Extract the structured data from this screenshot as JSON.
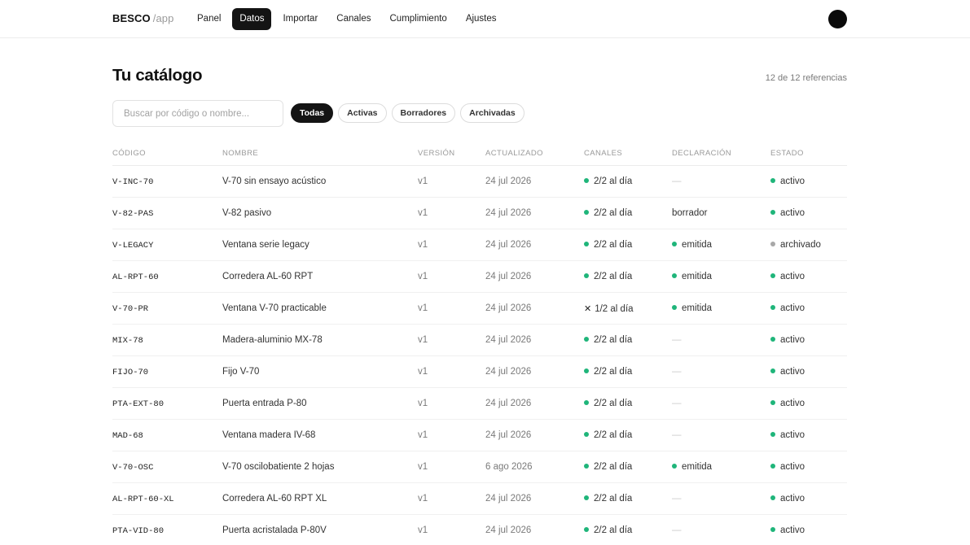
{
  "brand": {
    "name": "BESCO",
    "sub": "/app"
  },
  "nav": [
    {
      "label": "Panel",
      "active": false
    },
    {
      "label": "Datos",
      "active": true
    },
    {
      "label": "Importar",
      "active": false
    },
    {
      "label": "Canales",
      "active": false
    },
    {
      "label": "Cumplimiento",
      "active": false
    },
    {
      "label": "Ajustes",
      "active": false
    }
  ],
  "page": {
    "title": "Tu catálogo",
    "count": "12 de 12 referencias"
  },
  "search": {
    "placeholder": "Buscar por código o nombre...",
    "value": ""
  },
  "filters": [
    {
      "label": "Todas",
      "active": true
    },
    {
      "label": "Activas",
      "active": false
    },
    {
      "label": "Borradores",
      "active": false
    },
    {
      "label": "Archivadas",
      "active": false
    }
  ],
  "table": {
    "headers": [
      "Código",
      "Nombre",
      "Versión",
      "Actualizado",
      "Canales",
      "Declaración",
      "Estado"
    ],
    "rows": [
      {
        "code": "V-INC-70",
        "name": "V-70 sin ensayo acústico",
        "version": "v1",
        "updated": "24 jul 2026",
        "channels": "2/2 al día",
        "channels_ok": true,
        "declaration": "—",
        "declaration_dot": false,
        "status": "activo",
        "status_dot": "green"
      },
      {
        "code": "V-82-PAS",
        "name": "V-82 pasivo",
        "version": "v1",
        "updated": "24 jul 2026",
        "channels": "2/2 al día",
        "channels_ok": true,
        "declaration": "borrador",
        "declaration_dot": false,
        "status": "activo",
        "status_dot": "green"
      },
      {
        "code": "V-LEGACY",
        "name": "Ventana serie legacy",
        "version": "v1",
        "updated": "24 jul 2026",
        "channels": "2/2 al día",
        "channels_ok": true,
        "declaration": "emitida",
        "declaration_dot": true,
        "status": "archivado",
        "status_dot": "gray"
      },
      {
        "code": "AL-RPT-60",
        "name": "Corredera AL-60 RPT",
        "version": "v1",
        "updated": "24 jul 2026",
        "channels": "2/2 al día",
        "channels_ok": true,
        "declaration": "emitida",
        "declaration_dot": true,
        "status": "activo",
        "status_dot": "green"
      },
      {
        "code": "V-70-PR",
        "name": "Ventana V-70 practicable",
        "version": "v1",
        "updated": "24 jul 2026",
        "channels": "1/2 al día",
        "channels_ok": false,
        "declaration": "emitida",
        "declaration_dot": true,
        "status": "activo",
        "status_dot": "green"
      },
      {
        "code": "MIX-78",
        "name": "Madera-aluminio MX-78",
        "version": "v1",
        "updated": "24 jul 2026",
        "channels": "2/2 al día",
        "channels_ok": true,
        "declaration": "—",
        "declaration_dot": false,
        "status": "activo",
        "status_dot": "green"
      },
      {
        "code": "FIJO-70",
        "name": "Fijo V-70",
        "version": "v1",
        "updated": "24 jul 2026",
        "channels": "2/2 al día",
        "channels_ok": true,
        "declaration": "—",
        "declaration_dot": false,
        "status": "activo",
        "status_dot": "green"
      },
      {
        "code": "PTA-EXT-80",
        "name": "Puerta entrada P-80",
        "version": "v1",
        "updated": "24 jul 2026",
        "channels": "2/2 al día",
        "channels_ok": true,
        "declaration": "—",
        "declaration_dot": false,
        "status": "activo",
        "status_dot": "green"
      },
      {
        "code": "MAD-68",
        "name": "Ventana madera IV-68",
        "version": "v1",
        "updated": "24 jul 2026",
        "channels": "2/2 al día",
        "channels_ok": true,
        "declaration": "—",
        "declaration_dot": false,
        "status": "activo",
        "status_dot": "green"
      },
      {
        "code": "V-70-OSC",
        "name": "V-70 oscilobatiente 2 hojas",
        "version": "v1",
        "updated": "6 ago 2026",
        "channels": "2/2 al día",
        "channels_ok": true,
        "declaration": "emitida",
        "declaration_dot": true,
        "status": "activo",
        "status_dot": "green"
      },
      {
        "code": "AL-RPT-60-XL",
        "name": "Corredera AL-60 RPT XL",
        "version": "v1",
        "updated": "24 jul 2026",
        "channels": "2/2 al día",
        "channels_ok": true,
        "declaration": "—",
        "declaration_dot": false,
        "status": "activo",
        "status_dot": "green"
      },
      {
        "code": "PTA-VID-80",
        "name": "Puerta acristalada P-80V",
        "version": "v1",
        "updated": "24 jul 2026",
        "channels": "2/2 al día",
        "channels_ok": true,
        "declaration": "—",
        "declaration_dot": false,
        "status": "activo",
        "status_dot": "green"
      }
    ]
  },
  "colors": {
    "accent": "#141414",
    "ok": "#1fb57a",
    "archived": "#a8a8a8"
  }
}
